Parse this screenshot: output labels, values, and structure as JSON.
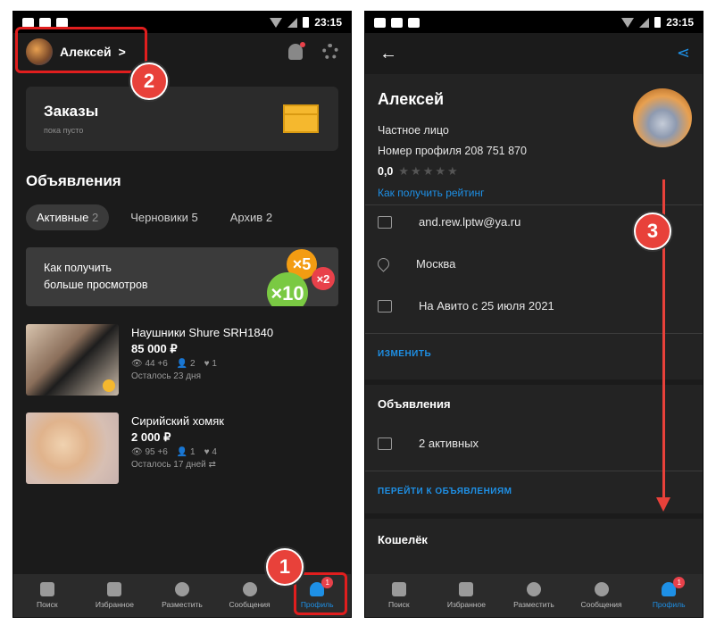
{
  "statusbar": {
    "time": "23:15"
  },
  "left": {
    "user_name": "Алексей",
    "chevron": ">",
    "orders": {
      "title": "Заказы",
      "subtitle": "пока пусто"
    },
    "listings_title": "Объявления",
    "tabs": [
      {
        "label": "Активные",
        "count": "2"
      },
      {
        "label": "Черновики",
        "count": "5"
      },
      {
        "label": "Архив",
        "count": "2"
      }
    ],
    "promo": {
      "line1": "Как получить",
      "line2": "больше просмотров",
      "badge_5": "×5",
      "badge_2": "×2",
      "badge_10": "×10"
    },
    "listings": [
      {
        "title": "Наушники Shure SRH1840",
        "price": "85 000 ₽",
        "views": "44 +6",
        "favs": "2",
        "likes": "1",
        "left": "Осталось 23 дня"
      },
      {
        "title": "Сирийский хомяк",
        "price": "2 000 ₽",
        "views": "95 +6",
        "favs": "1",
        "likes": "4",
        "left": "Осталось 17 дней"
      }
    ]
  },
  "nav": [
    {
      "label": "Поиск",
      "icon": "search-grid-icon"
    },
    {
      "label": "Избранное",
      "icon": "heart-icon"
    },
    {
      "label": "Разместить",
      "icon": "plus-icon"
    },
    {
      "label": "Сообщения",
      "icon": "chat-icon"
    },
    {
      "label": "Профиль",
      "icon": "profile-icon",
      "badge": "1"
    }
  ],
  "right": {
    "name": "Алексей",
    "type": "Частное лицо",
    "profile_number": "Номер профиля 208 751 870",
    "rating": "0,0",
    "stars": "★★★★★",
    "rating_link": "Как получить рейтинг",
    "email": "and.rew.lptw@ya.ru",
    "city": "Москва",
    "since": "На Авито с 25 июля 2021",
    "edit": "ИЗМЕНИТЬ",
    "listings_title": "Объявления",
    "active_count": "2 активных",
    "go_listings": "ПЕРЕЙТИ К ОБЪЯВЛЕНИЯМ",
    "wallet": "Кошелёк"
  },
  "steps": {
    "one": "1",
    "two": "2",
    "three": "3"
  },
  "colors": {
    "accent": "#1e90e6",
    "highlight": "#e01e1e",
    "step": "#e8413a"
  }
}
